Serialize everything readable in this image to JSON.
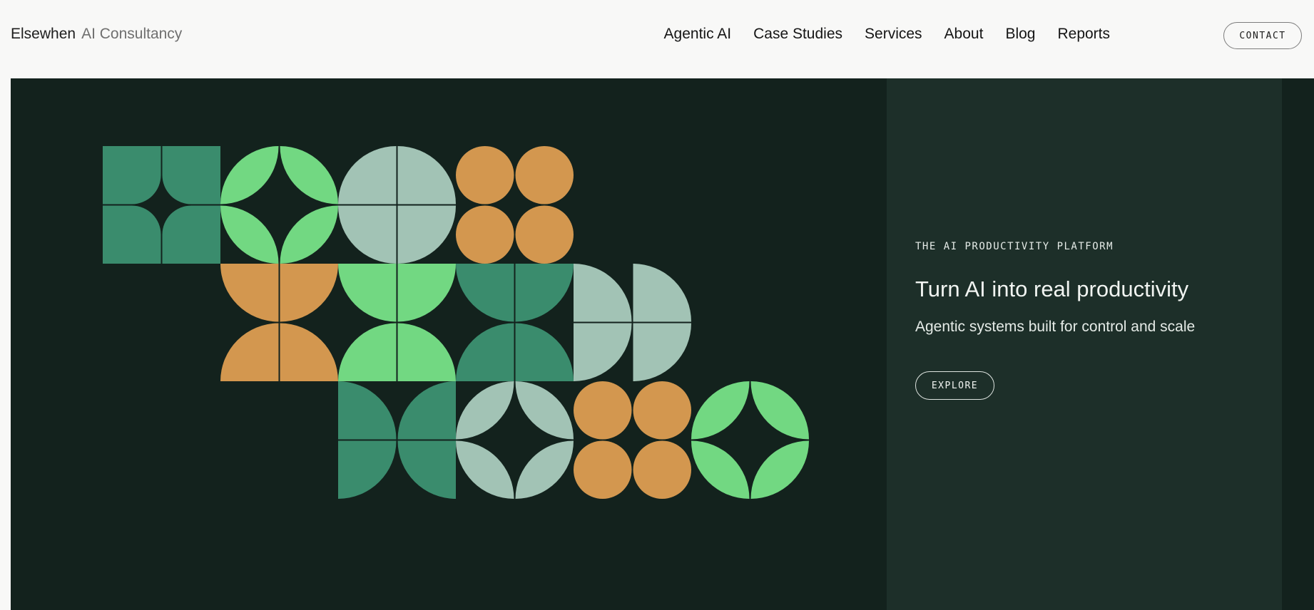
{
  "header": {
    "brand_name": "Elsewhen",
    "brand_sub": "AI Consultancy",
    "nav": [
      "Agentic AI",
      "Case Studies",
      "Services",
      "About",
      "Blog",
      "Reports"
    ],
    "contact_label": "CONTACT"
  },
  "hero": {
    "eyebrow": "THE AI PRODUCTIVITY PLATFORM",
    "headline": "Turn AI into real productivity",
    "subline": "Agentic systems built for control and scale",
    "cta_label": "EXPLORE"
  },
  "colors": {
    "hero_bg": "#13221d",
    "panel_bg": "#1d2f29",
    "dark_green": "#3a8c6d",
    "bright_green": "#72d882",
    "sage": "#a2c3b5",
    "orange": "#d3974f"
  },
  "pattern": [
    {
      "type": "rounded-quads",
      "color": "dark_green"
    },
    {
      "type": "leaves",
      "color": "bright_green"
    },
    {
      "type": "quarter-pies-out",
      "color": "sage"
    },
    {
      "type": "circles",
      "color": "orange"
    },
    {
      "type": "half-discs",
      "color": "orange"
    },
    {
      "type": "quarter-pies-in",
      "color": "bright_green"
    },
    {
      "type": "arch-down",
      "color": "dark_green"
    },
    {
      "type": "quarter-pies-right",
      "color": "sage"
    },
    {
      "type": "quarter-pies-center",
      "color": "dark_green"
    },
    {
      "type": "leaves",
      "color": "sage"
    },
    {
      "type": "circles",
      "color": "orange"
    },
    {
      "type": "leaves",
      "color": "bright_green"
    }
  ]
}
